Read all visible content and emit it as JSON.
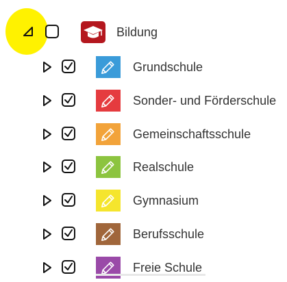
{
  "parent": {
    "label": "Bildung",
    "expanded": true,
    "checked": false,
    "icon": "graduation-cap-icon",
    "icon_color": "#b4171e"
  },
  "children": [
    {
      "label": "Grundschule",
      "checked": true,
      "icon": "pencil-icon",
      "color": "#3a9bd9"
    },
    {
      "label": "Sonder- und Förderschule",
      "checked": true,
      "icon": "pencil-icon",
      "color": "#e53b3f"
    },
    {
      "label": "Gemeinschaftsschule",
      "checked": true,
      "icon": "pencil-icon",
      "color": "#f2a33a"
    },
    {
      "label": "Realschule",
      "checked": true,
      "icon": "pencil-icon",
      "color": "#8cc43f"
    },
    {
      "label": "Gymnasium",
      "checked": true,
      "icon": "pencil-icon",
      "color": "#f5e52d"
    },
    {
      "label": "Berufsschule",
      "checked": true,
      "icon": "pencil-icon",
      "color": "#a0663b"
    },
    {
      "label": "Freie Schule",
      "checked": true,
      "icon": "pencil-icon",
      "color": "#9a4aa8"
    }
  ],
  "highlight_color": "#fff200"
}
